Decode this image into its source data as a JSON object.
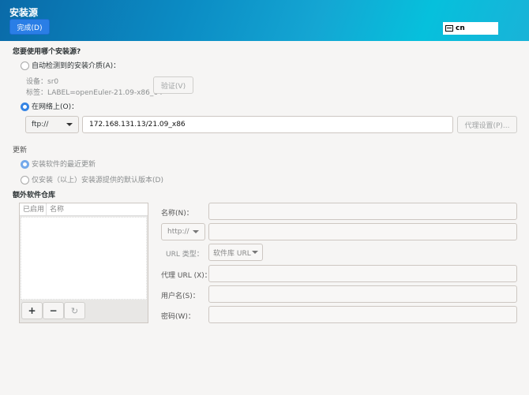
{
  "header": {
    "title": "安装源",
    "done_label": "完成(D)",
    "keyboard_layout": "cn",
    "accent": "#2a7ee6"
  },
  "source": {
    "question": "您要使用哪个安装源?",
    "auto_option": "自动检测到的安装介质(A)：",
    "device_label": "设备：sr0",
    "label_label": "标签：LABEL=openEuler-21.09-x86_64",
    "verify_label": "验证(V)",
    "network_option": "在网络上(O)：",
    "selected": "network",
    "protocol": "ftp://",
    "url": "172.168.131.13/21.09_x86",
    "proxy_label": "代理设置(P)..."
  },
  "updates": {
    "heading": "更新",
    "option_latest": "安装软件的最近更新",
    "option_default": "仅安装（以上）安装源提供的默认版本(D)",
    "selected": "latest"
  },
  "repos": {
    "heading": "额外软件仓库",
    "columns": [
      "已启用",
      "名称"
    ],
    "rows": [],
    "add": "+",
    "remove": "−",
    "name_label": "名称(N)：",
    "name_value": "",
    "protocol": "http://",
    "url_value": "",
    "url_type_label": "URL 类型：",
    "url_type": "软件库 URL",
    "proxy_url_label": "代理 URL (X)：",
    "proxy_url_value": "",
    "username_label": "用户名(S)：",
    "username_value": "",
    "password_label": "密码(W)：",
    "password_value": ""
  }
}
